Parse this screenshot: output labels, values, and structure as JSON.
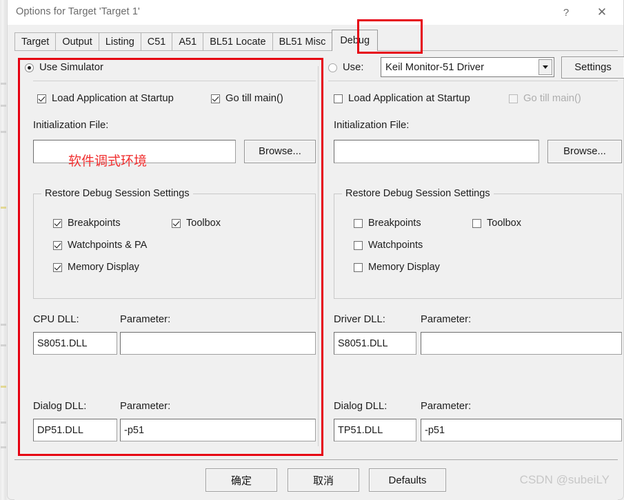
{
  "window": {
    "title": "Options for Target 'Target 1'",
    "help_label": "?",
    "close_label": "✕"
  },
  "tabs": [
    {
      "label": "Target",
      "active": false
    },
    {
      "label": "Output",
      "active": false
    },
    {
      "label": "Listing",
      "active": false
    },
    {
      "label": "C51",
      "active": false
    },
    {
      "label": "A51",
      "active": false
    },
    {
      "label": "BL51 Locate",
      "active": false
    },
    {
      "label": "BL51 Misc",
      "active": false
    },
    {
      "label": "Debug",
      "active": true
    }
  ],
  "simulator": {
    "radio_label": "Use Simulator",
    "radio_checked": true,
    "load_app_label": "Load Application at Startup",
    "load_app_checked": true,
    "go_till_main_label": "Go  till main()",
    "go_till_main_checked": true,
    "init_file_label": "Initialization File:",
    "init_file_value": "",
    "browse_label": "Browse...",
    "restore_group_title": "Restore Debug Session Settings",
    "restore_items": [
      {
        "label": "Breakpoints",
        "checked": true
      },
      {
        "label": "Toolbox",
        "checked": true
      },
      {
        "label": "Watchpoints & PA",
        "checked": true
      },
      {
        "label": "Memory Display",
        "checked": true
      }
    ],
    "cpu_dll_label": "CPU DLL:",
    "cpu_dll_value": "S8051.DLL",
    "cpu_param_label": "Parameter:",
    "cpu_param_value": "",
    "dialog_dll_label": "Dialog DLL:",
    "dialog_dll_value": "DP51.DLL",
    "dialog_param_label": "Parameter:",
    "dialog_param_value": "-p51"
  },
  "driver": {
    "radio_label": "Use:",
    "radio_checked": false,
    "combo_value": "Keil Monitor-51 Driver",
    "settings_label": "Settings",
    "load_app_label": "Load Application at Startup",
    "load_app_checked": false,
    "go_till_main_label": "Go  till main()",
    "go_till_main_checked": false,
    "init_file_label": "Initialization File:",
    "init_file_value": "",
    "browse_label": "Browse...",
    "restore_group_title": "Restore Debug Session Settings",
    "restore_items": [
      {
        "label": "Breakpoints",
        "checked": false
      },
      {
        "label": "Toolbox",
        "checked": false
      },
      {
        "label": "Watchpoints",
        "checked": false
      },
      {
        "label": "Memory Display",
        "checked": false
      }
    ],
    "driver_dll_label": "Driver DLL:",
    "driver_dll_value": "S8051.DLL",
    "driver_param_label": "Parameter:",
    "driver_param_value": "",
    "dialog_dll_label": "Dialog DLL:",
    "dialog_dll_value": "TP51.DLL",
    "dialog_param_label": "Parameter:",
    "dialog_param_value": "-p51"
  },
  "annotation": {
    "text": "软件调式环境",
    "color": "#f03030"
  },
  "highlight": {
    "color": "#e60012"
  },
  "footer": {
    "ok_label": "确定",
    "cancel_label": "取消",
    "defaults_label": "Defaults",
    "watermark": "CSDN @subeiLY"
  }
}
